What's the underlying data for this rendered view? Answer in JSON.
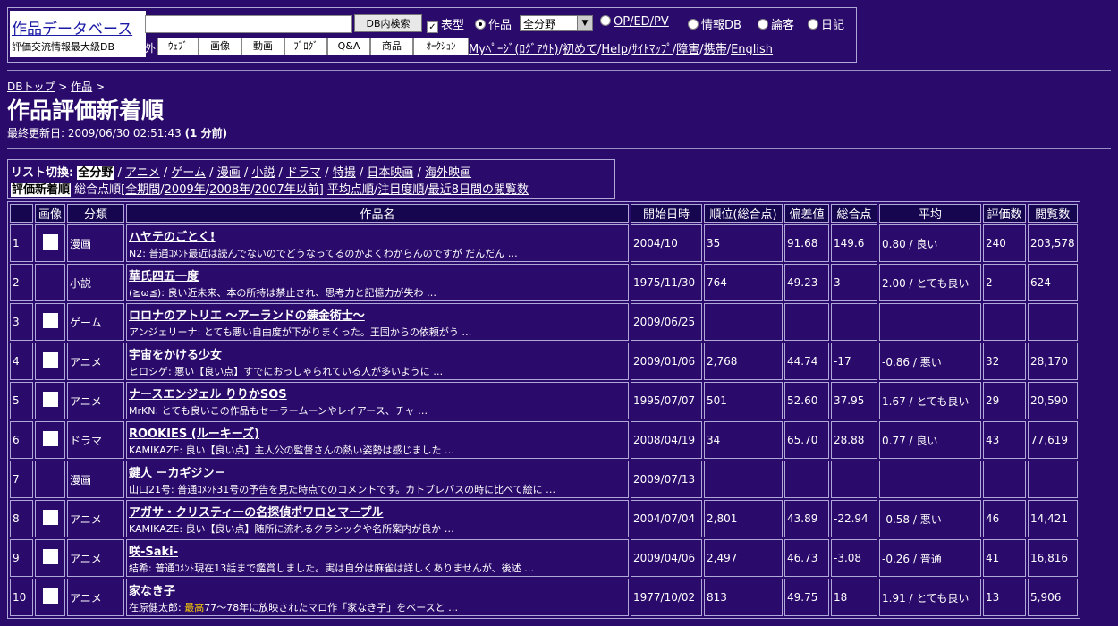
{
  "header": {
    "logo_title": "作品データベース",
    "logo_sub": "評価交流情報最大級DB",
    "search_button": "DB内検索",
    "opt_table": "表型",
    "opt_work": "作品",
    "select_value": "全分野",
    "opt_oped": "OP/ED/PV",
    "opt_info": "情報DB",
    "opt_review": "論客",
    "opt_diary": "日記",
    "external_label": "外",
    "tabs": [
      "ｳｪﾌﾞ",
      "画像",
      "動画",
      "ﾌﾞﾛｸﾞ",
      "Q&A",
      "商品",
      "ｵｰｸｼｮﾝ"
    ],
    "links": [
      "Myﾍﾟｰｼﾞ(ﾛｸﾞｱｳﾄ)",
      "初めて",
      "Help",
      "ｻｲﾄﾏｯﾌﾟ",
      "障害",
      "携帯",
      "English"
    ]
  },
  "breadcrumb": [
    "DBトップ",
    "作品"
  ],
  "page_title": "作品評価新着順",
  "updated_label": "最終更新日: ",
  "updated_value": "2009/06/30 02:51:43",
  "updated_ago": "(1 分前)",
  "list_switch": {
    "label": "リスト切換:",
    "categories": [
      "全分野",
      "アニメ",
      "ゲーム",
      "漫画",
      "小説",
      "ドラマ",
      "特撮",
      "日本映画",
      "海外映画"
    ],
    "row2_active": "評価新着順",
    "row2_text": "総合点順",
    "row2_periods": [
      "全期間",
      "2009年",
      "2008年",
      "2007年以前"
    ],
    "row2_links": [
      "平均点順",
      "注目度順",
      "最近8日間の閲覧数"
    ]
  },
  "table": {
    "headers": [
      "",
      "画像",
      "分類",
      "作品名",
      "開始日時",
      "順位(総合点)",
      "偏差値",
      "総合点",
      "平均",
      "評価数",
      "閲覧数"
    ],
    "rows": [
      {
        "no": "1",
        "img": true,
        "cat": "漫画",
        "name": "ハヤテのごとく!",
        "user": "N2",
        "grade": "普通",
        "comment": "ｺﾒﾝﾄ最近は読んでないのでどうなってるのかよくわからんのですが だんだん …",
        "start": "2004/10",
        "rank": "35",
        "dev": "91.68",
        "total": "149.6",
        "avg": "0.80 / 良い",
        "count": "240",
        "views": "203,578"
      },
      {
        "no": "2",
        "img": false,
        "cat": "小説",
        "name": "華氏四五一度",
        "user": "(≧ω≦)",
        "grade": "良い",
        "comment": "近未来、本の所持は禁止され、思考力と記憶力が失わ …",
        "start": "1975/11/30",
        "rank": "764",
        "dev": "49.23",
        "total": "3",
        "avg": "2.00 / とても良い",
        "count": "2",
        "views": "624"
      },
      {
        "no": "3",
        "img": true,
        "cat": "ゲーム",
        "name": "ロロナのアトリエ ～アーランドの錬金術士～",
        "user": "アンジェリーナ",
        "grade": "とても悪い",
        "comment": "自由度が下がりまくった。王国からの依頼がう …",
        "start": "2009/06/25",
        "rank": "",
        "dev": "",
        "total": "",
        "avg": "",
        "count": "",
        "views": ""
      },
      {
        "no": "4",
        "img": true,
        "cat": "アニメ",
        "name": "宇宙をかける少女",
        "user": "ヒロシゲ",
        "grade": "悪い",
        "comment": "【良い点】すでにおっしゃられている人が多いように …",
        "start": "2009/01/06",
        "rank": "2,768",
        "dev": "44.74",
        "total": "-17",
        "avg": "-0.86 / 悪い",
        "count": "32",
        "views": "28,170"
      },
      {
        "no": "5",
        "img": true,
        "cat": "アニメ",
        "name": "ナースエンジェル りりかSOS",
        "user": "MrKN",
        "grade": "とても良い",
        "comment": "この作品もセーラームーンやレイアース、チャ …",
        "start": "1995/07/07",
        "rank": "501",
        "dev": "52.60",
        "total": "37.95",
        "avg": "1.67 / とても良い",
        "count": "29",
        "views": "20,590"
      },
      {
        "no": "6",
        "img": true,
        "cat": "ドラマ",
        "name": "ROOKIES (ルーキーズ)",
        "user": "KAMIKAZE",
        "grade": "良い",
        "comment": "【良い点】主人公の監督さんの熱い姿勢は感じました …",
        "start": "2008/04/19",
        "rank": "34",
        "dev": "65.70",
        "total": "28.88",
        "avg": "0.77 / 良い",
        "count": "43",
        "views": "77,619"
      },
      {
        "no": "7",
        "img": false,
        "cat": "漫画",
        "name": "鍵人 －カギジン－",
        "user": "山口21号",
        "grade": "普通",
        "comment": "ｺﾒﾝﾄ31号の予告を見た時点でのコメントです。カトブレパスの時に比べて絵に …",
        "start": "2009/07/13",
        "rank": "",
        "dev": "",
        "total": "",
        "avg": "",
        "count": "",
        "views": ""
      },
      {
        "no": "8",
        "img": true,
        "cat": "アニメ",
        "name": "アガサ・クリスティーの名探偵ポワロとマープル",
        "user": "KAMIKAZE",
        "grade": "良い",
        "comment": "【良い点】随所に流れるクラシックや名所案内が良か …",
        "start": "2004/07/04",
        "rank": "2,801",
        "dev": "43.89",
        "total": "-22.94",
        "avg": "-0.58 / 悪い",
        "count": "46",
        "views": "14,421"
      },
      {
        "no": "9",
        "img": true,
        "cat": "アニメ",
        "name": "咲-Saki-",
        "user": "結希",
        "grade": "普通",
        "comment": "ｺﾒﾝﾄ現在13話まで鑑賞しました。実は自分は麻雀は詳しくありませんが、後述 …",
        "start": "2009/04/06",
        "rank": "2,497",
        "dev": "46.73",
        "total": "-3.08",
        "avg": "-0.26 / 普通",
        "count": "41",
        "views": "16,816"
      },
      {
        "no": "10",
        "img": true,
        "cat": "アニメ",
        "name": "家なき子",
        "user": "在原健太郎",
        "grade": "最高",
        "comment": "77～78年に放映されたマロ作「家なき子」をベースと …",
        "start": "1977/10/02",
        "rank": "813",
        "dev": "49.75",
        "total": "18",
        "avg": "1.91 / とても良い",
        "count": "13",
        "views": "5,906"
      }
    ]
  },
  "colors": {
    "background": "#2a0a6b",
    "header_cell": "#160650",
    "border": "#b0a8d8",
    "highlight_best": "#ffd400"
  }
}
